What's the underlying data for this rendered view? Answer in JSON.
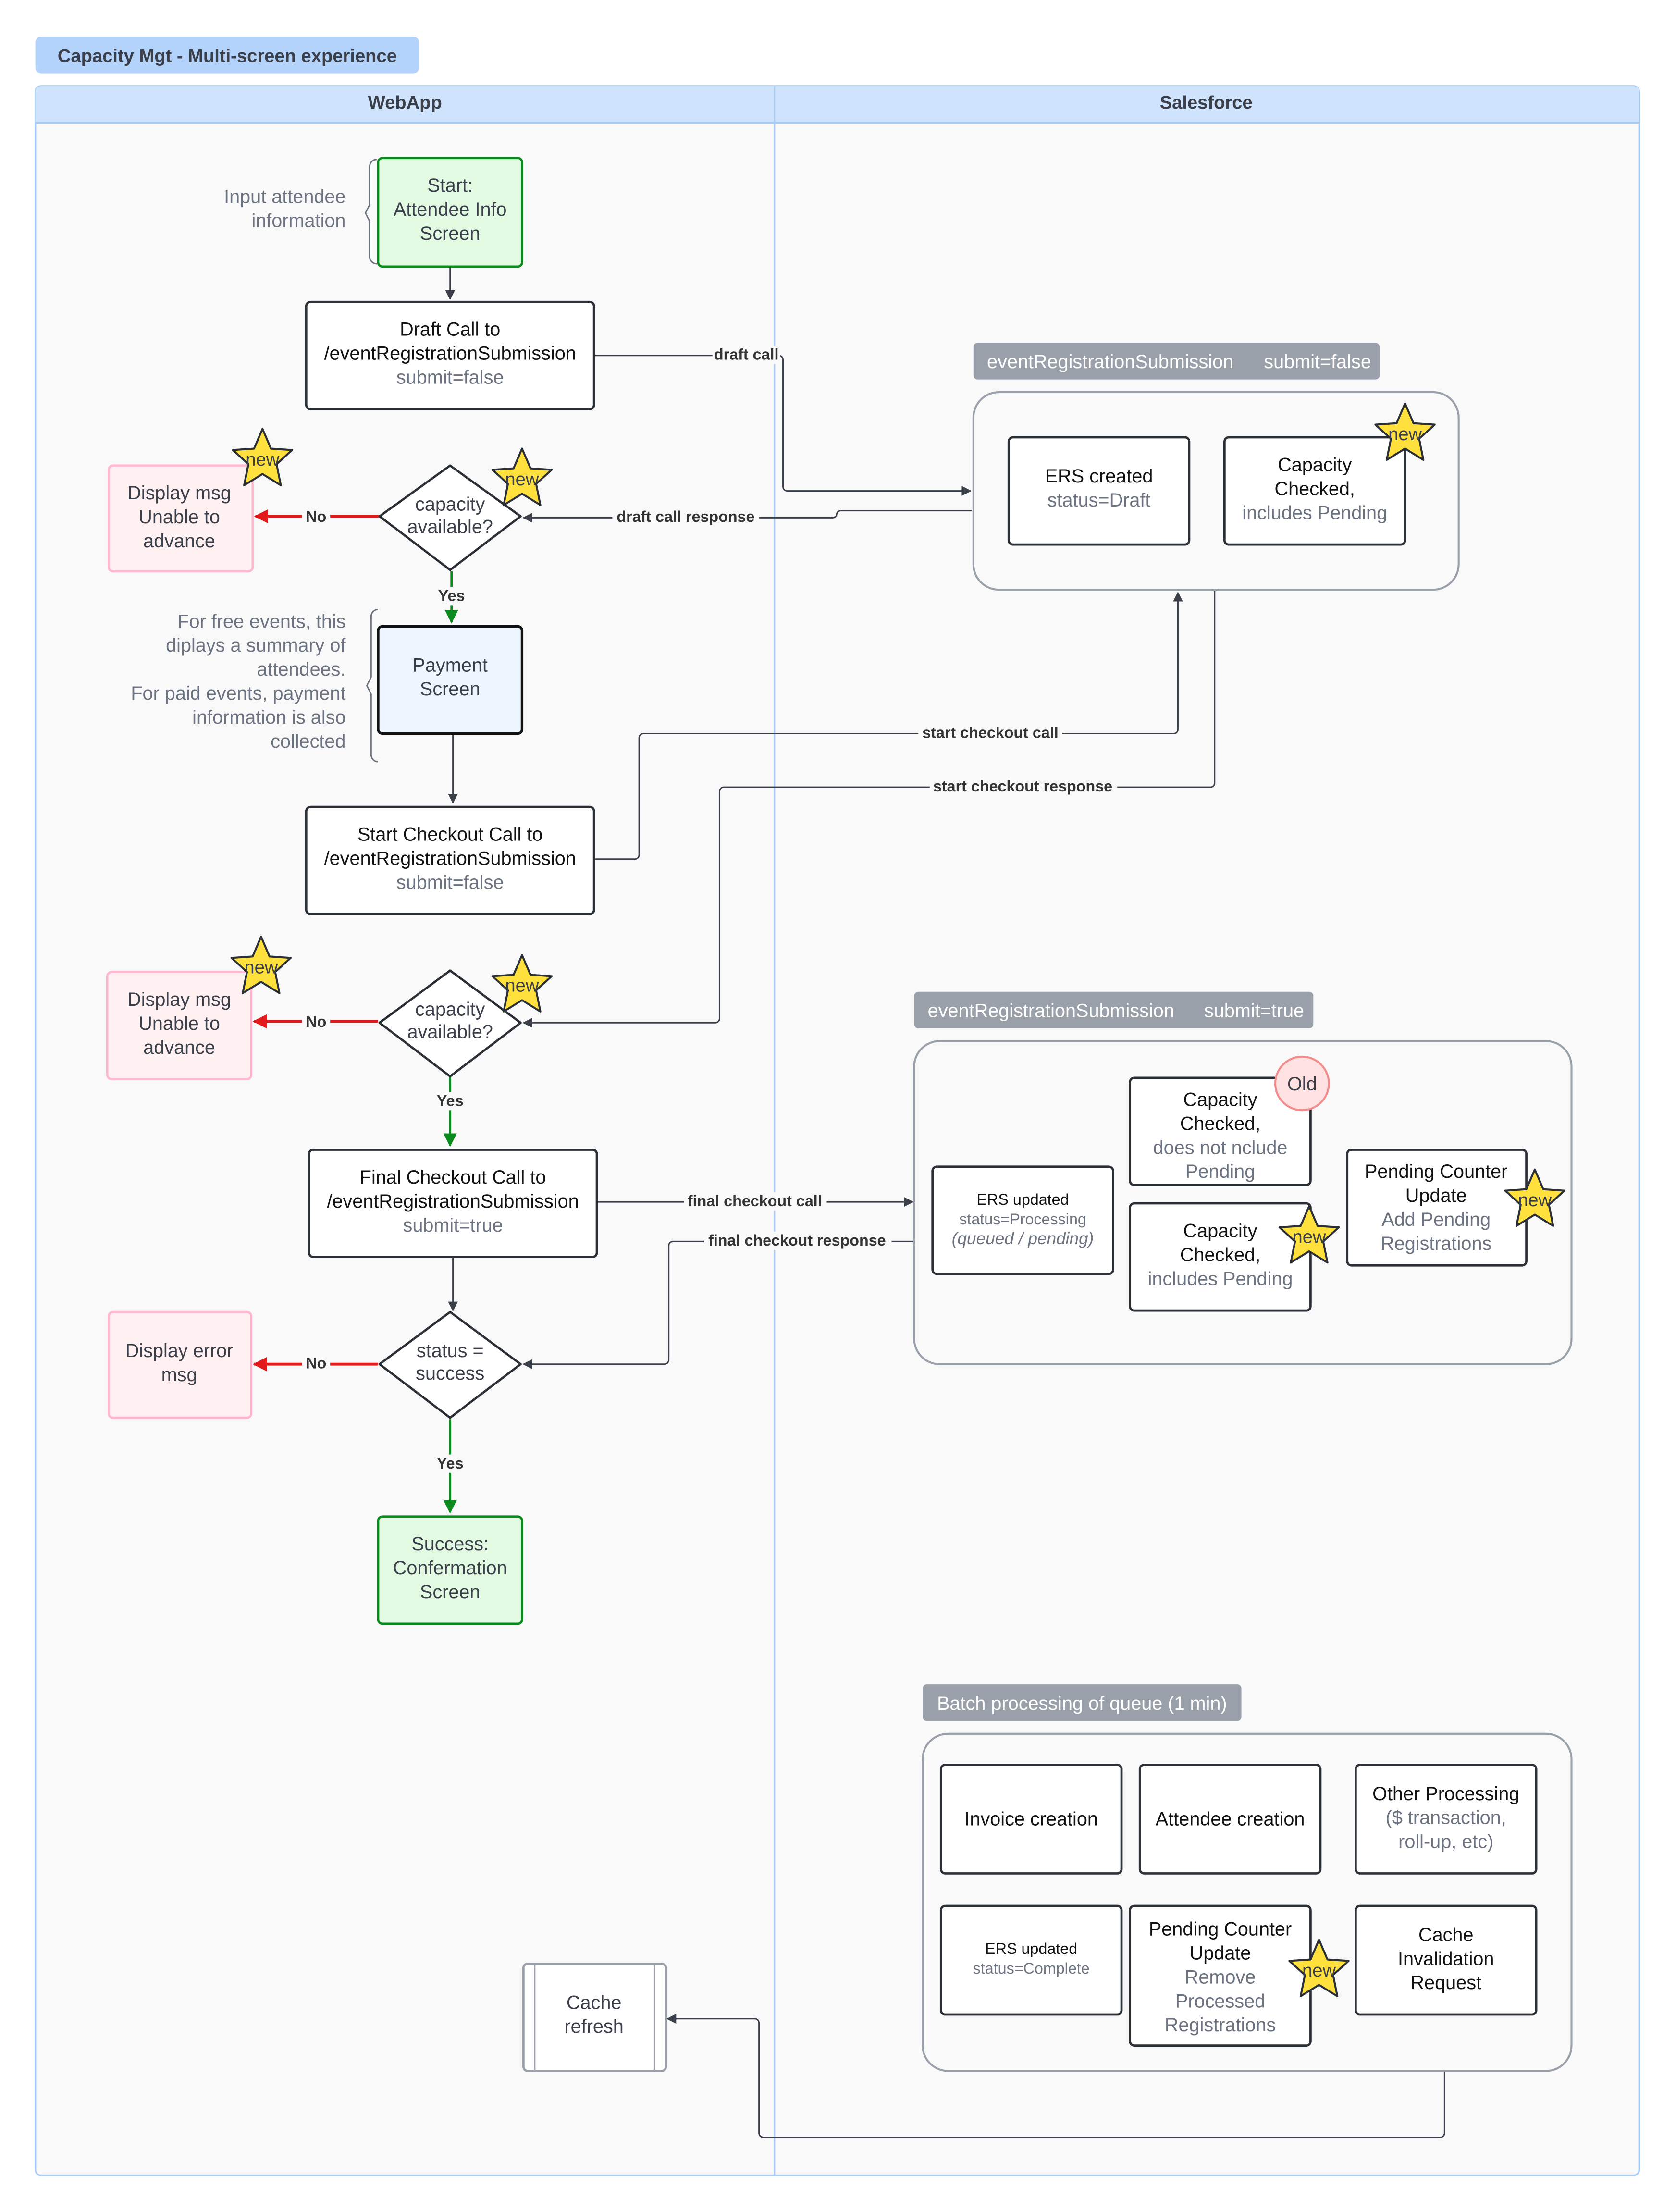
{
  "title": "Capacity Mgt - Multi-screen experience",
  "lanes": [
    {
      "name": "WebApp"
    },
    {
      "name": "Salesforce"
    }
  ],
  "colors": {
    "title_bg": "#b3d3fb",
    "lane_header_bg": "#cfe3fd",
    "lane_border": "#a9cdf7",
    "lane_body_bg": "#f9f9fa",
    "start_fill": "#e2f9e2",
    "start_stroke": "#0b8a1e",
    "error_fill": "#fff0f1",
    "error_stroke": "#ffb8cf",
    "payment_fill": "#edf5ff",
    "group_label_bg": "#9aa0a9",
    "star_fill": "#ffe03d",
    "old_fill": "#ffe1e2",
    "old_stroke": "#f28b8b",
    "yes_color": "#0b8a1e",
    "no_color": "#e11b1b"
  },
  "webapp": {
    "start": {
      "lines": [
        "Start:",
        "Attendee Info",
        "Screen"
      ]
    },
    "start_note": {
      "lines": [
        "Input attendee",
        "information"
      ]
    },
    "draft_call": {
      "lines": [
        "Draft Call to",
        "/eventRegistrationSubmission"
      ],
      "sub": "submit=false"
    },
    "decision1": {
      "lines": [
        "capacity",
        "available?"
      ],
      "badge": "new"
    },
    "display1": {
      "lines": [
        "Display msg",
        "Unable to",
        "advance"
      ],
      "badge": "new"
    },
    "payment": {
      "lines": [
        "Payment",
        "Screen"
      ]
    },
    "payment_note": {
      "lines": [
        "For free events, this",
        "diplays a summary of",
        "attendees.",
        "For paid events, payment",
        "information is also",
        "collected"
      ]
    },
    "start_checkout": {
      "lines": [
        "Start Checkout Call to",
        "/eventRegistrationSubmission"
      ],
      "sub": "submit=false"
    },
    "decision2": {
      "lines": [
        "capacity",
        "available?"
      ],
      "badge": "new"
    },
    "display2": {
      "lines": [
        "Display msg",
        "Unable to",
        "advance"
      ],
      "badge": "new"
    },
    "final_checkout": {
      "lines": [
        "Final Checkout Call to",
        "/eventRegistrationSubmission"
      ],
      "sub": "submit=true"
    },
    "decision3": {
      "lines": [
        "status =",
        "success"
      ]
    },
    "display_error": {
      "lines": [
        "Display error",
        "msg"
      ]
    },
    "success": {
      "lines": [
        "Success:",
        "Confermation",
        "Screen"
      ]
    },
    "cache_refresh": {
      "lines": [
        "Cache",
        "refresh"
      ]
    }
  },
  "salesforce": {
    "group1": {
      "label_a": "eventRegistrationSubmission",
      "label_b": "submit=false",
      "ers_created": {
        "title": "ERS created",
        "sub": "status=Draft"
      },
      "capacity_checked": {
        "lines": [
          "Capacity",
          "Checked,"
        ],
        "sub": "includes Pending",
        "badge": "new"
      }
    },
    "group2": {
      "label_a": "eventRegistrationSubmission",
      "label_b": "submit=true",
      "ers_updated": {
        "title": "ERS updated",
        "sub": "status=Processing",
        "sub2": "(queued / pending)"
      },
      "capacity_old": {
        "lines": [
          "Capacity",
          "Checked,"
        ],
        "sub": [
          "does not nclude",
          "Pending"
        ],
        "badge": "Old"
      },
      "capacity_new": {
        "lines": [
          "Capacity",
          "Checked,"
        ],
        "sub": "includes Pending",
        "badge": "new"
      },
      "pending_counter": {
        "lines": [
          "Pending Counter",
          "Update"
        ],
        "sub": [
          "Add Pending",
          "Registrations"
        ],
        "badge": "new"
      }
    },
    "group3": {
      "label": "Batch processing of queue (1 min)",
      "invoice": "Invoice creation",
      "attendee": "Attendee creation",
      "other": {
        "title": "Other Processing",
        "sub": [
          "($ transaction,",
          "roll-up, etc)"
        ]
      },
      "ers_complete": {
        "title": "ERS updated",
        "sub": "status=Complete"
      },
      "pending_remove": {
        "lines": [
          "Pending Counter",
          "Update"
        ],
        "sub": [
          "Remove",
          "Processed",
          "Registrations"
        ],
        "badge": "new"
      },
      "cache_invalidation": {
        "lines": [
          "Cache",
          "Invalidation",
          "Request"
        ]
      }
    }
  },
  "connectors": {
    "draft_call": "draft call",
    "draft_response": "draft call response",
    "start_checkout_call": "start checkout call",
    "start_checkout_response": "start checkout response",
    "final_checkout_call": "final checkout call",
    "final_checkout_response": "final checkout response",
    "yes": "Yes",
    "no": "No"
  }
}
